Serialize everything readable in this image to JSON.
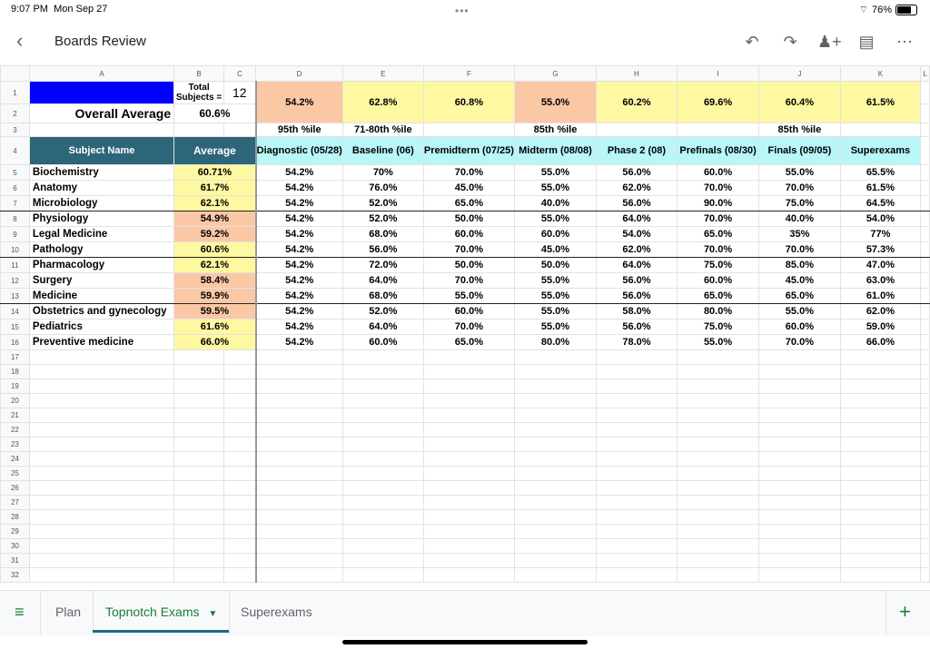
{
  "status": {
    "time": "9:07 PM",
    "date": "Mon Sep 27",
    "battery": "76%",
    "battery_level": 0.76
  },
  "header": {
    "title": "Boards Review"
  },
  "columns": [
    "A",
    "B",
    "C",
    "D",
    "E",
    "F",
    "G",
    "H",
    "I",
    "J",
    "K",
    "L"
  ],
  "summary": {
    "total_label": "Total Subjects =",
    "total": "12",
    "overall_label": "Overall Average",
    "overall": "60.6%",
    "subject_header": "Subject Name",
    "average_header": "Average",
    "exams": [
      {
        "pct": "54.2%",
        "tone": "orange",
        "pctile": "95th %ile",
        "name": "Diagnostic (05/28)"
      },
      {
        "pct": "62.8%",
        "tone": "yellow",
        "pctile": "71-80th %ile",
        "name": "Baseline (06)"
      },
      {
        "pct": "60.8%",
        "tone": "yellow",
        "pctile": "",
        "name": "Premidterm (07/25)"
      },
      {
        "pct": "55.0%",
        "tone": "orange",
        "pctile": "85th %ile",
        "name": "Midterm (08/08)"
      },
      {
        "pct": "60.2%",
        "tone": "yellow",
        "pctile": "",
        "name": "Phase 2 (08)"
      },
      {
        "pct": "69.6%",
        "tone": "yellow",
        "pctile": "",
        "name": "Prefinals (08/30)"
      },
      {
        "pct": "60.4%",
        "tone": "yellow",
        "pctile": "85th %ile",
        "name": "Finals (09/05)"
      },
      {
        "pct": "61.5%",
        "tone": "yellow",
        "pctile": "",
        "name": "Superexams"
      }
    ]
  },
  "subjects": [
    {
      "row": "5",
      "name": "Biochemistry",
      "avg": "60.71%",
      "tone": "yellow",
      "scores": [
        "54.2%",
        "70%",
        "70.0%",
        "55.0%",
        "56.0%",
        "60.0%",
        "55.0%",
        "65.5%"
      ]
    },
    {
      "row": "6",
      "name": "Anatomy",
      "avg": "61.7%",
      "tone": "yellow",
      "scores": [
        "54.2%",
        "76.0%",
        "45.0%",
        "55.0%",
        "62.0%",
        "70.0%",
        "70.0%",
        "61.5%"
      ]
    },
    {
      "row": "7",
      "name": "Microbiology",
      "avg": "62.1%",
      "tone": "yellow",
      "scores": [
        "54.2%",
        "52.0%",
        "65.0%",
        "40.0%",
        "56.0%",
        "90.0%",
        "75.0%",
        "64.5%"
      ]
    },
    {
      "row": "8",
      "name": "Physiology",
      "avg": "54.9%",
      "tone": "orange",
      "scores": [
        "54.2%",
        "52.0%",
        "50.0%",
        "55.0%",
        "64.0%",
        "70.0%",
        "40.0%",
        "54.0%"
      ]
    },
    {
      "row": "9",
      "name": "Legal Medicine",
      "avg": "59.2%",
      "tone": "orange",
      "scores": [
        "54.2%",
        "68.0%",
        "60.0%",
        "60.0%",
        "54.0%",
        "65.0%",
        "35%",
        "77%"
      ]
    },
    {
      "row": "10",
      "name": "Pathology",
      "avg": "60.6%",
      "tone": "yellow",
      "scores": [
        "54.2%",
        "56.0%",
        "70.0%",
        "45.0%",
        "62.0%",
        "70.0%",
        "70.0%",
        "57.3%"
      ]
    },
    {
      "row": "11",
      "name": "Pharmacology",
      "avg": "62.1%",
      "tone": "yellow",
      "scores": [
        "54.2%",
        "72.0%",
        "50.0%",
        "50.0%",
        "64.0%",
        "75.0%",
        "85.0%",
        "47.0%"
      ]
    },
    {
      "row": "12",
      "name": "Surgery",
      "avg": "58.4%",
      "tone": "orange",
      "scores": [
        "54.2%",
        "64.0%",
        "70.0%",
        "55.0%",
        "56.0%",
        "60.0%",
        "45.0%",
        "63.0%"
      ]
    },
    {
      "row": "13",
      "name": "Medicine",
      "avg": "59.9%",
      "tone": "orange",
      "scores": [
        "54.2%",
        "68.0%",
        "55.0%",
        "55.0%",
        "56.0%",
        "65.0%",
        "65.0%",
        "61.0%"
      ]
    },
    {
      "row": "14",
      "name": "Obstetrics and gynecology",
      "avg": "59.5%",
      "tone": "orange",
      "scores": [
        "54.2%",
        "52.0%",
        "60.0%",
        "55.0%",
        "58.0%",
        "80.0%",
        "55.0%",
        "62.0%"
      ]
    },
    {
      "row": "15",
      "name": "Pediatrics",
      "avg": "61.6%",
      "tone": "yellow",
      "scores": [
        "54.2%",
        "64.0%",
        "70.0%",
        "55.0%",
        "56.0%",
        "75.0%",
        "60.0%",
        "59.0%"
      ]
    },
    {
      "row": "16",
      "name": "Preventive medicine",
      "avg": "66.0%",
      "tone": "yellow",
      "scores": [
        "54.2%",
        "60.0%",
        "65.0%",
        "80.0%",
        "78.0%",
        "55.0%",
        "70.0%",
        "66.0%"
      ]
    }
  ],
  "empty_rows": [
    "17",
    "18",
    "19",
    "20",
    "21",
    "22",
    "23",
    "24",
    "25",
    "26",
    "27",
    "28",
    "29",
    "30",
    "31",
    "32"
  ],
  "tabs": {
    "plan": "Plan",
    "active": "Topnotch Exams",
    "super": "Superexams"
  },
  "colors": {
    "orange": "#fbc8a5",
    "yellow": "#fdf8a1",
    "teal": "#2d6579",
    "cyan": "#b8f6f7",
    "blue": "#0000ff"
  }
}
